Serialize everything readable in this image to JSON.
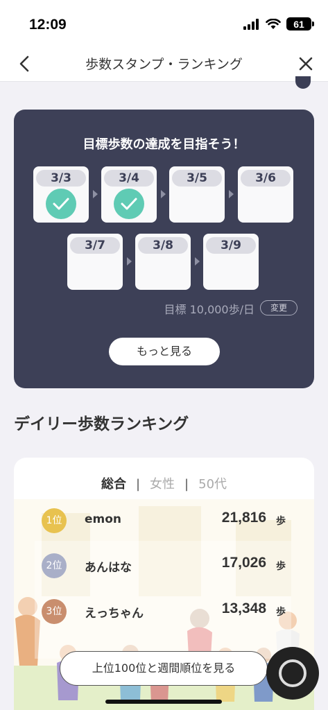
{
  "status": {
    "time": "12:09",
    "battery": "61"
  },
  "nav": {
    "title": "歩数スタンプ・ランキング"
  },
  "goal": {
    "title": "目標歩数の達成を目指そう！",
    "stamps": [
      {
        "date": "3/3",
        "achieved": true
      },
      {
        "date": "3/4",
        "achieved": true
      },
      {
        "date": "3/5",
        "achieved": false
      },
      {
        "date": "3/6",
        "achieved": false
      },
      {
        "date": "3/7",
        "achieved": false
      },
      {
        "date": "3/8",
        "achieved": false
      },
      {
        "date": "3/9",
        "achieved": false
      }
    ],
    "target_text": "目標 10,000歩/日",
    "change_label": "変更",
    "more_label": "もっと見る"
  },
  "ranking": {
    "section_title": "デイリー歩数ランキング",
    "tabs": {
      "overall": "総合",
      "sep": "|",
      "female": "女性",
      "age": "50代"
    },
    "rows": [
      {
        "rank": "1位",
        "name": "emon",
        "steps": "21,816",
        "unit": "歩",
        "color": "#e8c24f"
      },
      {
        "rank": "2位",
        "name": "あんはな",
        "steps": "17,026",
        "unit": "歩",
        "color": "#a9afc8"
      },
      {
        "rank": "3位",
        "name": "えっちゃん",
        "steps": "13,348",
        "unit": "歩",
        "color": "#c98e6e"
      }
    ],
    "view_more_label": "上位100位と週間順位を見る"
  },
  "colors": {
    "card": "#3d4057",
    "check": "#5fcbb4",
    "background": "#f2f1f6"
  }
}
